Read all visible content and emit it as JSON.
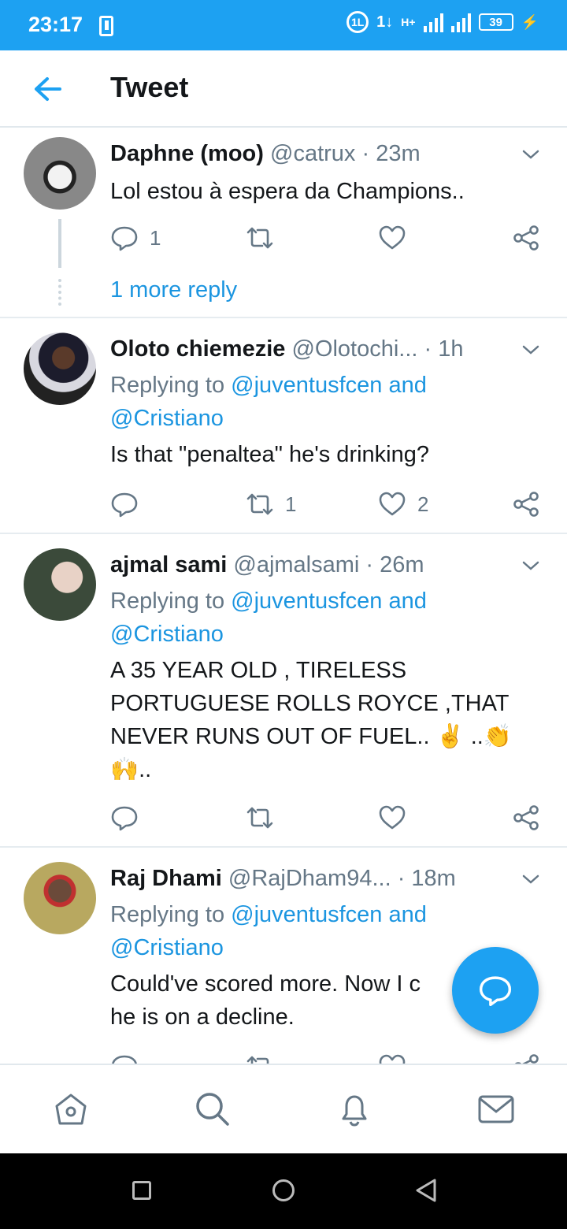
{
  "status_bar": {
    "time": "23:17",
    "net_label": "1L",
    "sim_indicator": "1↓",
    "network_type": "H+",
    "battery": "39"
  },
  "header": {
    "title": "Tweet"
  },
  "tweets": [
    {
      "name": "Daphne (moo)",
      "handle": "@catrux",
      "time": "· 23m",
      "text": "Lol estou à espera da Champions..",
      "reply_count": "1",
      "retweet_count": "",
      "like_count": "",
      "more_replies": "1 more reply"
    },
    {
      "name": "Oloto chiemezie",
      "handle": "@Olotochi...",
      "time": "· 1h",
      "replying_prefix": "Replying to",
      "replying_to_1": "@juventusfcen",
      "replying_and": "and",
      "replying_to_2": "@Cristiano",
      "text": "Is that \"penaltea\" he's drinking?",
      "reply_count": "",
      "retweet_count": "1",
      "like_count": "2"
    },
    {
      "name": "ajmal sami",
      "handle": "@ajmalsami",
      "time": "· 26m",
      "replying_prefix": "Replying to",
      "replying_to_1": "@juventusfcen",
      "replying_and": "and",
      "replying_to_2": "@Cristiano",
      "text_line1": "A 35 YEAR OLD , TIRELESS",
      "text_line2": "PORTUGUESE ROLLS ROYCE  ,THAT",
      "text_line3": "NEVER RUNS OUT OF FUEL.. ✌️ ..👏",
      "text_line4": "🙌..",
      "reply_count": "",
      "retweet_count": "",
      "like_count": ""
    },
    {
      "name": "Raj Dhami",
      "handle": "@RajDham94...",
      "time": "· 18m",
      "replying_prefix": "Replying to",
      "replying_to_1": "@juventusfcen",
      "replying_and": "and",
      "replying_to_2": "@Cristiano",
      "text_line1": "Could've scored more. Now I c",
      "text_line2": "he is on a decline."
    }
  ],
  "colors": {
    "brand_blue": "#1da1f2",
    "link_blue": "#1b95e0",
    "muted_gray": "#657786"
  },
  "bottom_nav": {
    "items": [
      "home-icon",
      "search-icon",
      "notifications-icon",
      "messages-icon"
    ]
  }
}
